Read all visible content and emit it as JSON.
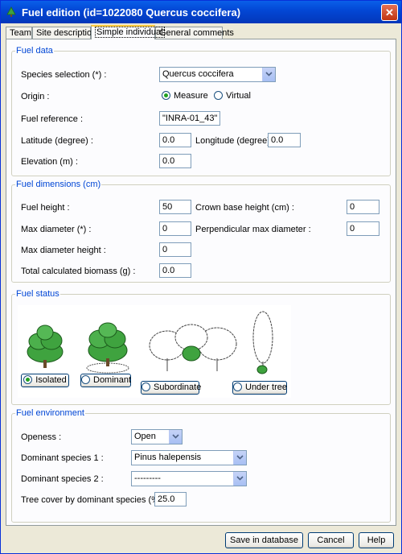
{
  "window": {
    "title": "Fuel edition  (id=1022080 Quercus coccifera)",
    "close_icon": "close-icon"
  },
  "tabs": [
    {
      "label": "Team"
    },
    {
      "label": "Site description"
    },
    {
      "label": "Simple individual",
      "active": true
    },
    {
      "label": "General comments"
    }
  ],
  "fuel_data": {
    "legend": "Fuel data",
    "species_label": "Species selection (*) :",
    "species_value": "Quercus coccifera",
    "origin_label": "Origin :",
    "origin_options": [
      {
        "label": "Measure",
        "selected": true
      },
      {
        "label": "Virtual",
        "selected": false
      }
    ],
    "reference_label": "Fuel reference :",
    "reference_value": "\"INRA-01_43\"",
    "latitude_label": "Latitude (degree) :",
    "latitude_value": "0.0",
    "longitude_label": "Longitude (degree) :",
    "longitude_value": "0.0",
    "elevation_label": "Elevation (m) :",
    "elevation_value": "0.0"
  },
  "fuel_dimensions": {
    "legend": "Fuel  dimensions (cm)",
    "height_label": "Fuel height :",
    "height_value": "50",
    "crown_base_label": "Crown base height (cm) :",
    "crown_base_value": "0",
    "max_diameter_label": "Max diameter (*) :",
    "max_diameter_value": "0",
    "perp_diameter_label": "Perpendicular max diameter :",
    "perp_diameter_value": "0",
    "max_diameter_height_label": "Max diameter height :",
    "max_diameter_height_value": "0",
    "biomass_label": "Total calculated biomass (g) :",
    "biomass_value": "0.0"
  },
  "fuel_status": {
    "legend": "Fuel status",
    "options": [
      {
        "label": "Isolated",
        "selected": true
      },
      {
        "label": "Dominant",
        "selected": false
      },
      {
        "label": "Subordinate",
        "selected": false
      },
      {
        "label": "Under tree",
        "selected": false
      }
    ]
  },
  "fuel_environment": {
    "legend": "Fuel environment",
    "openess_label": "Openess  :",
    "openess_value": "Open",
    "dominant1_label": "Dominant species 1 :",
    "dominant1_value": "Pinus halepensis",
    "dominant2_label": "Dominant species 2 :",
    "dominant2_value": "---------",
    "tree_cover_label": "Tree cover by dominant species (%)  :",
    "tree_cover_value": "25.0"
  },
  "buttons": {
    "save": "Save in database",
    "cancel": "Cancel",
    "help": "Help"
  },
  "colors": {
    "title_bar": "#0348d6",
    "legend_text": "#0046d5",
    "tab_active_accent": "#ffc83c",
    "foliage_green": "#3fa33f"
  }
}
